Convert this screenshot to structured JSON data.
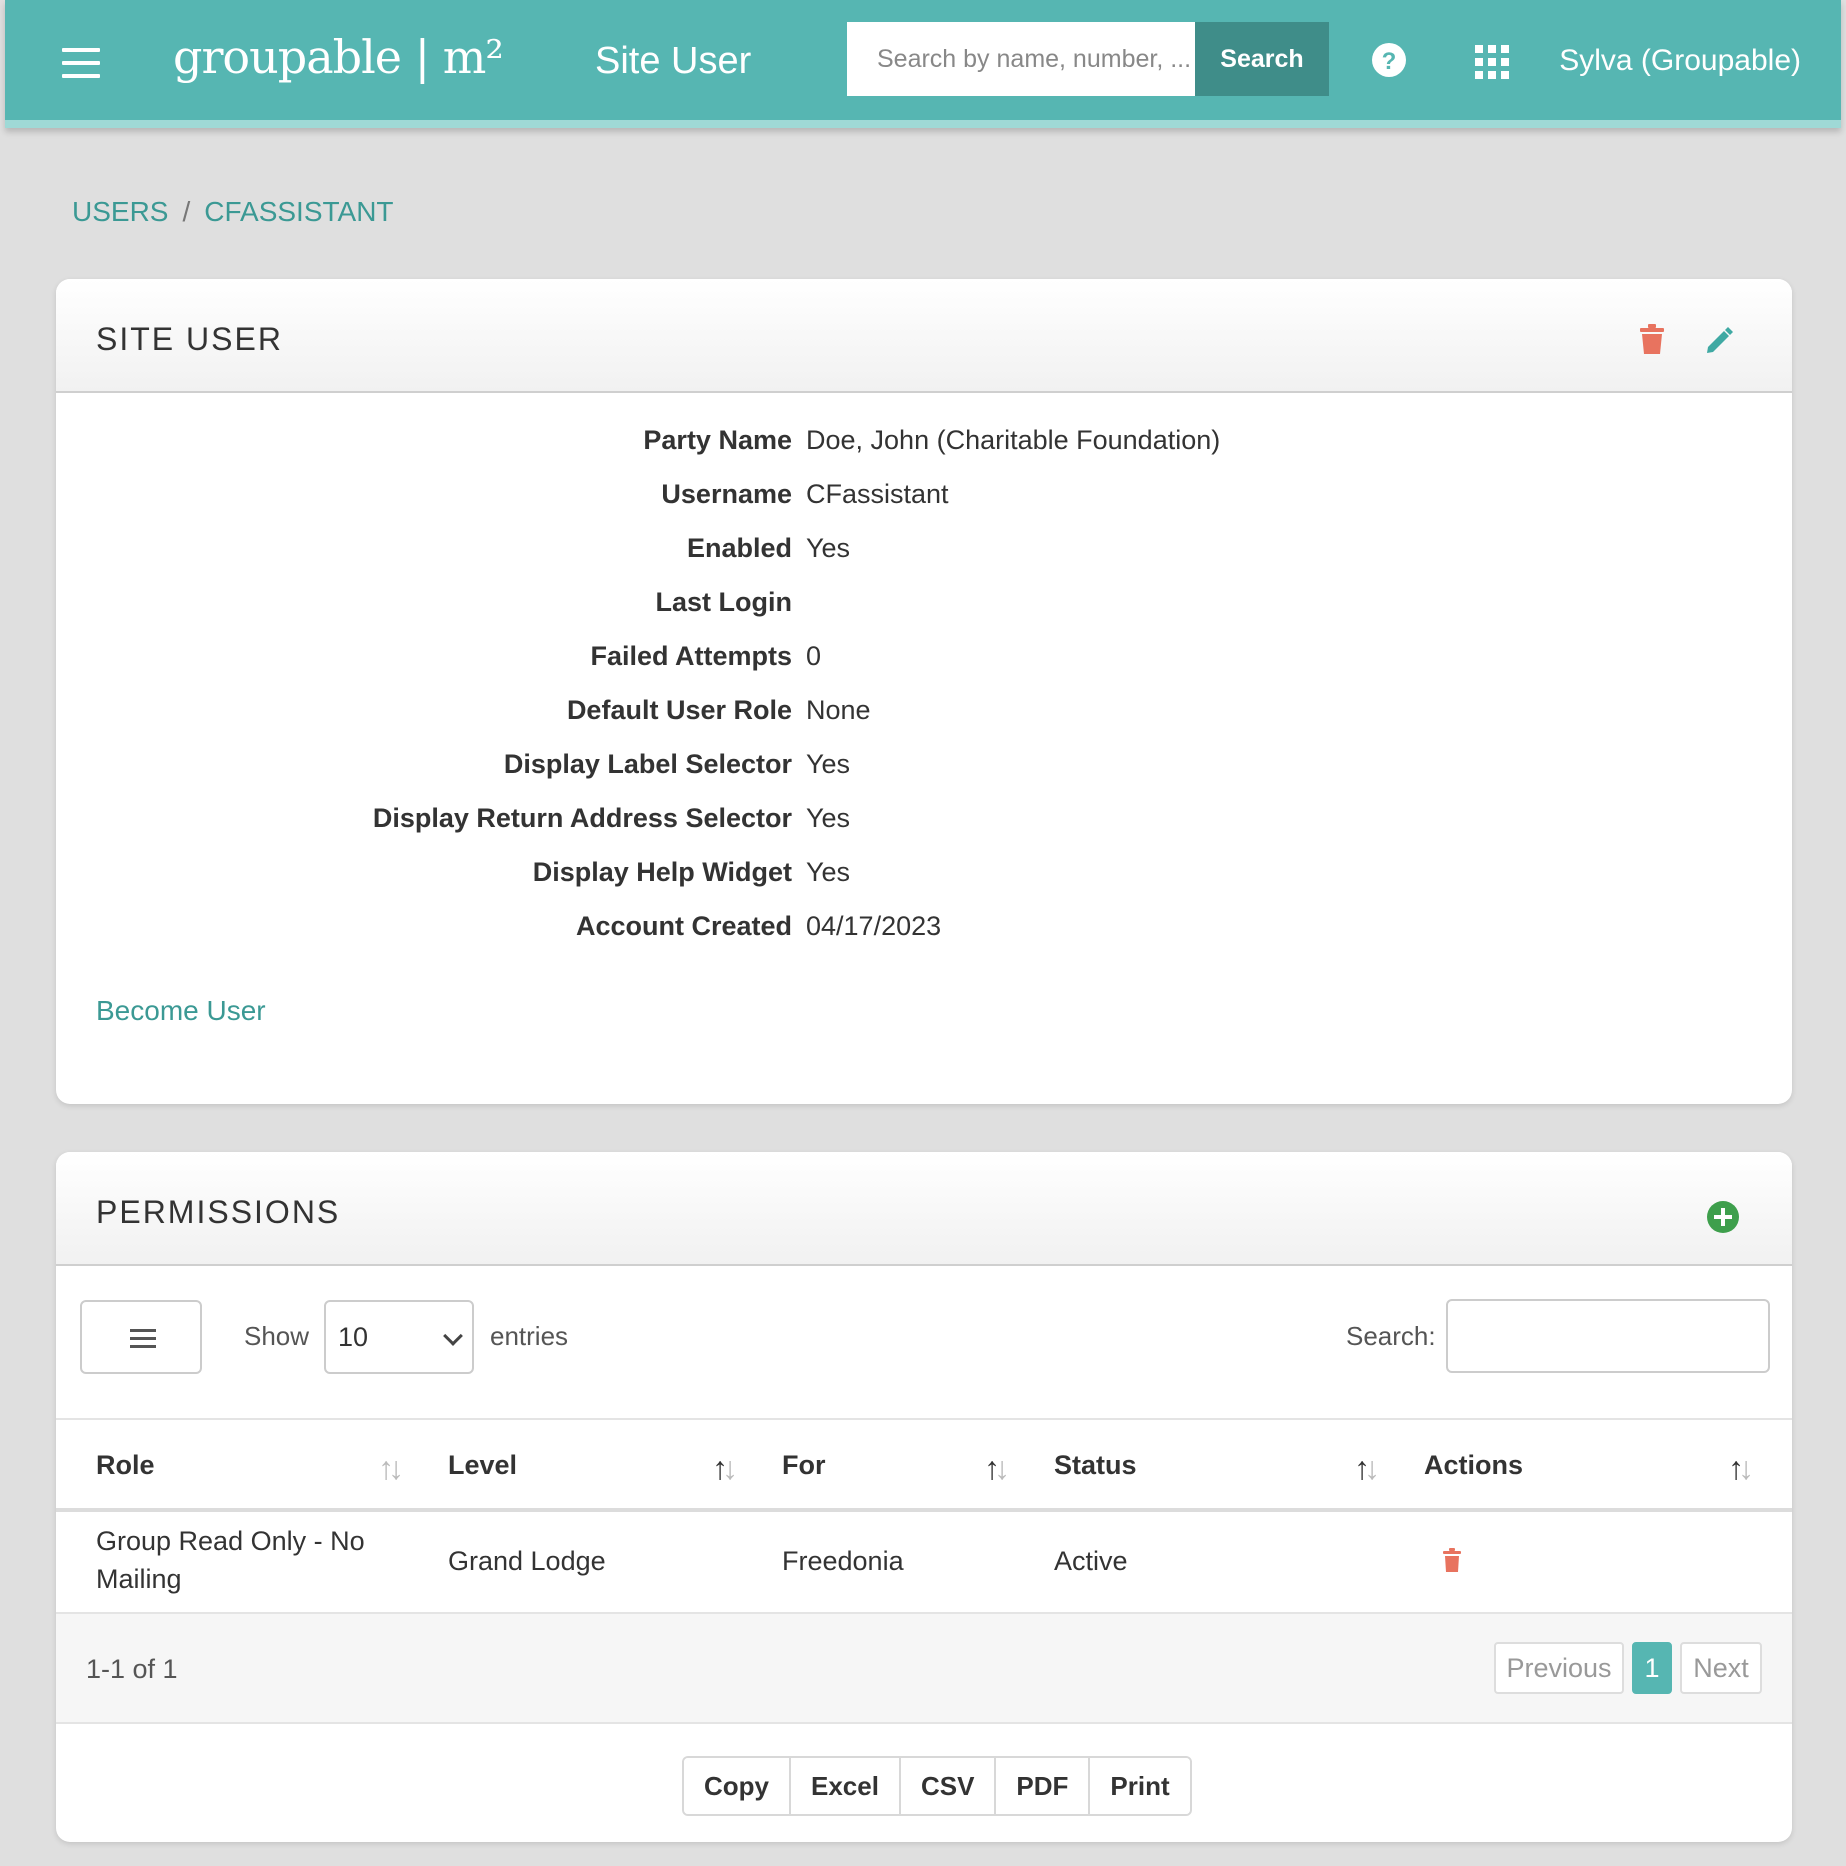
{
  "header": {
    "logo": "groupable | m²",
    "app_title": "Site User",
    "search_placeholder": "Search by name, number, ...",
    "search_button": "Search",
    "user": "Sylva (Groupable)",
    "accent_color": "#56b6b2"
  },
  "breadcrumb": {
    "users": "USERS",
    "separator": "/",
    "current": "CFASSISTANT"
  },
  "site_user": {
    "title": "SITE USER",
    "fields": [
      {
        "label": "Party Name",
        "value": "Doe, John (Charitable Foundation)"
      },
      {
        "label": "Username",
        "value": "CFassistant"
      },
      {
        "label": "Enabled",
        "value": "Yes"
      },
      {
        "label": "Last Login",
        "value": ""
      },
      {
        "label": "Failed Attempts",
        "value": "0"
      },
      {
        "label": "Default User Role",
        "value": "None"
      },
      {
        "label": "Display Label Selector",
        "value": "Yes"
      },
      {
        "label": "Display Return Address Selector",
        "value": "Yes"
      },
      {
        "label": "Display Help Widget",
        "value": "Yes"
      },
      {
        "label": "Account Created",
        "value": "04/17/2023"
      }
    ],
    "become_user": "Become User"
  },
  "permissions": {
    "title": "PERMISSIONS",
    "show_label": "Show",
    "entries_value": "10",
    "entries_label": "entries",
    "search_label": "Search:",
    "columns": [
      "Role",
      "Level",
      "For",
      "Status",
      "Actions"
    ],
    "rows": [
      {
        "role": "Group Read Only - No Mailing",
        "level": "Grand Lodge",
        "for": "Freedonia",
        "status": "Active"
      }
    ],
    "info": "1-1 of 1",
    "pagination": {
      "previous": "Previous",
      "current": "1",
      "next": "Next"
    },
    "export_buttons": [
      "Copy",
      "Excel",
      "CSV",
      "PDF",
      "Print"
    ]
  }
}
